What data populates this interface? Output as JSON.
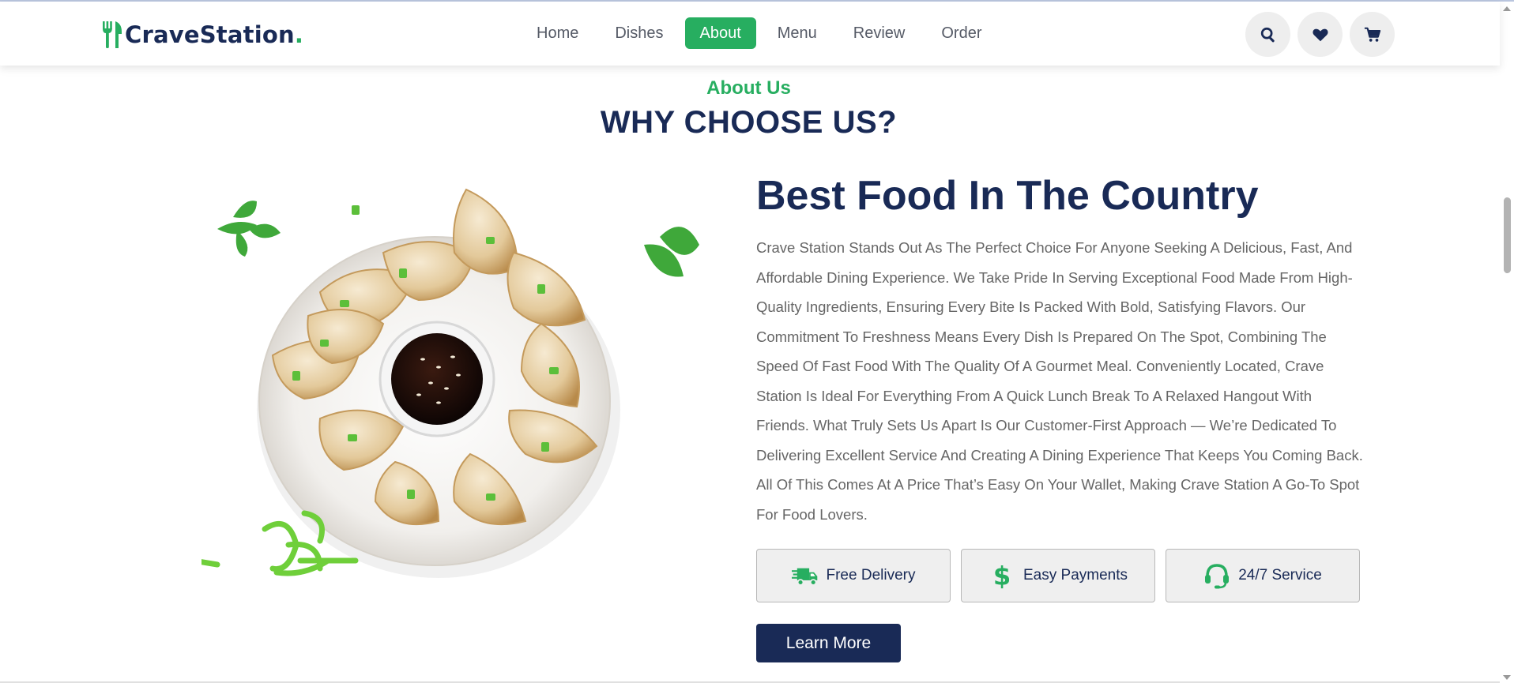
{
  "brand": {
    "name": "CraveStation",
    "dot": "."
  },
  "nav": {
    "items": [
      {
        "label": "Home",
        "active": false
      },
      {
        "label": "Dishes",
        "active": false
      },
      {
        "label": "About",
        "active": true
      },
      {
        "label": "Menu",
        "active": false
      },
      {
        "label": "Review",
        "active": false
      },
      {
        "label": "Order",
        "active": false
      }
    ]
  },
  "header_icons": [
    "search-icon",
    "heart-icon",
    "cart-icon"
  ],
  "section": {
    "sub_heading": "About Us",
    "heading": "WHY CHOOSE US?"
  },
  "about": {
    "title": "Best Food In The Country",
    "paragraph": "Crave Station Stands Out As The Perfect Choice For Anyone Seeking A Delicious, Fast, And Affordable Dining Experience. We Take Pride In Serving Exceptional Food Made From High-Quality Ingredients, Ensuring Every Bite Is Packed With Bold, Satisfying Flavors. Our Commitment To Freshness Means Every Dish Is Prepared On The Spot, Combining The Speed Of Fast Food With The Quality Of A Gourmet Meal. Conveniently Located, Crave Station Is Ideal For Everything From A Quick Lunch Break To A Relaxed Hangout With Friends. What Truly Sets Us Apart Is Our Customer-First Approach — We’re Dedicated To Delivering Excellent Service And Creating A Dining Experience That Keeps You Coming Back. All Of This Comes At A Price That’s Easy On Your Wallet, Making Crave Station A Go-To Spot For Food Lovers.",
    "features": [
      {
        "label": "Free Delivery",
        "icon": "shipping-fast-icon"
      },
      {
        "label": "Easy Payments",
        "icon": "dollar-icon"
      },
      {
        "label": "24/7 Service",
        "icon": "headset-icon"
      }
    ],
    "button": "Learn More",
    "image_alt": "dumplings-dish"
  },
  "colors": {
    "primary": "#27ae60",
    "dark": "#192a56",
    "text": "#666666",
    "icon_bg": "#eeeeee"
  }
}
